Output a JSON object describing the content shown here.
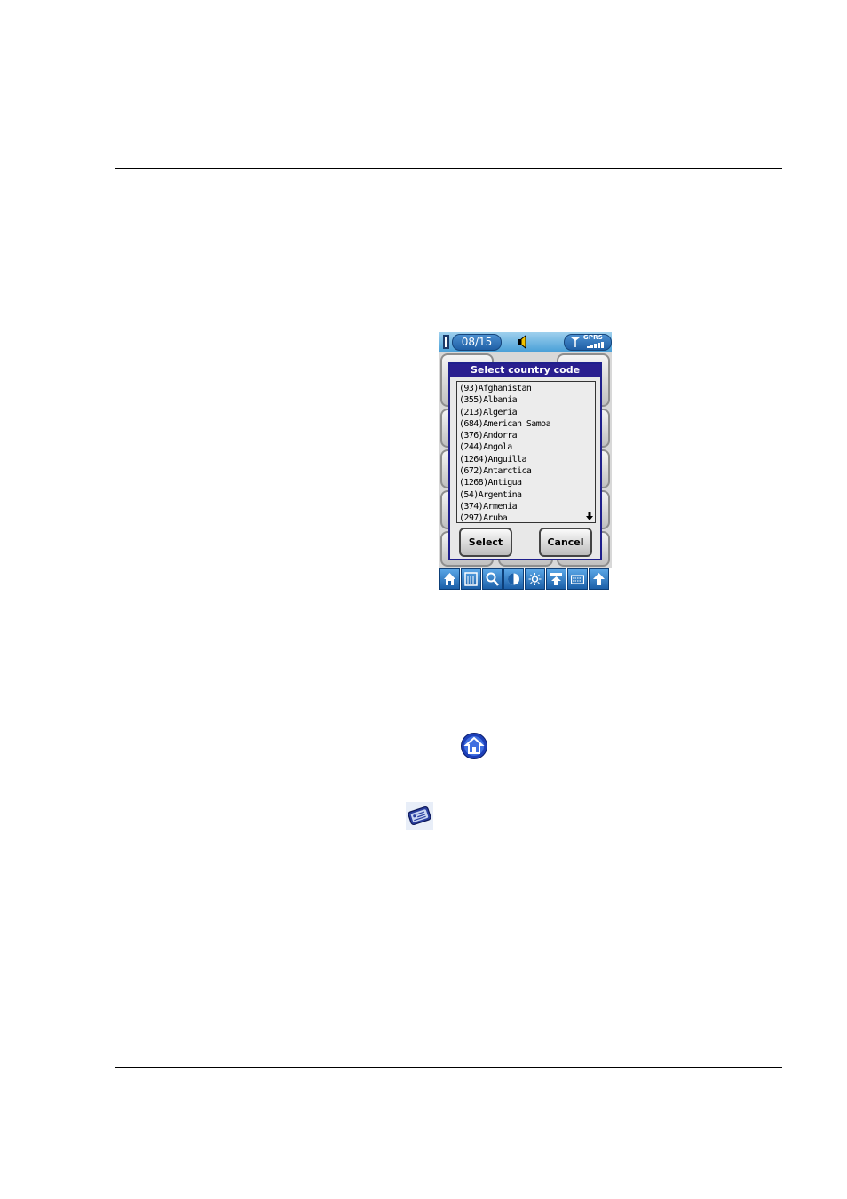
{
  "status_bar": {
    "date": "08/15",
    "network": "GPRS"
  },
  "dialog": {
    "title": "Select country code",
    "countries": [
      "(93)Afghanistan",
      "(355)Albania",
      "(213)Algeria",
      "(684)American Samoa",
      "(376)Andorra",
      "(244)Angola",
      "(1264)Anguilla",
      "(672)Antarctica",
      "(1268)Antigua",
      "(54)Argentina",
      "(374)Armenia",
      "(297)Aruba"
    ],
    "select_label": "Select",
    "cancel_label": "Cancel"
  },
  "toolbar": {
    "icons": [
      "home-icon",
      "applications-icon",
      "search-icon",
      "contrast-icon",
      "brightness-icon",
      "sync-icon",
      "keyboard-icon",
      "shift-up-icon"
    ]
  },
  "colors": {
    "title_bar": "#2a1f8f",
    "status_bar": "#4aa0d8",
    "toolbar_button": "#1b5fa8"
  }
}
